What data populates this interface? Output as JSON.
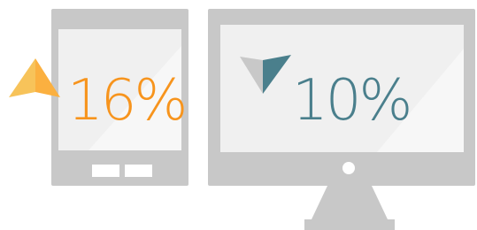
{
  "tablet": {
    "value_text": "16%",
    "trend": "up",
    "color": "#f7941d",
    "arrow_colors": [
      "#fbb040",
      "#f7c35a"
    ]
  },
  "desktop": {
    "value_text": "10%",
    "trend": "down",
    "color": "#4a7f8c",
    "arrow_colors": [
      "#4a7f8c",
      "#c8c8c8"
    ]
  },
  "device_color": "#c8c8c8",
  "screen_color": "#f0f0f0"
}
